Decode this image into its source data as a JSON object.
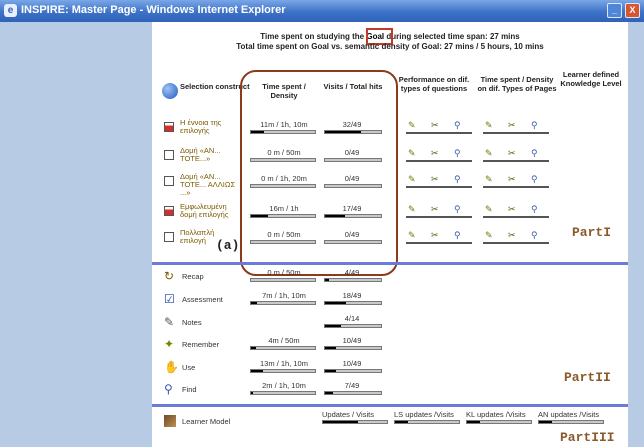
{
  "window": {
    "title": "INSPIRE: Master Page - Windows Internet Explorer",
    "icon": "ie-icon",
    "min_label": "_",
    "close_label": "X"
  },
  "summary": {
    "line1_prefix": "Time spent on studying the ",
    "line1_goal": "Goal",
    "line1_suffix": " during selected time span: 27 mins",
    "line2": "Total time spent on Goal vs. semantic density of Goal: 27 mins / 5 hours, 10 mins"
  },
  "headers": {
    "selection": "Selection construct",
    "time_density": "Time spent / Density",
    "visits": "Visits / Total hits",
    "performance": "Performance on dif. types of questions",
    "time_pages": "Time spent / Density on dif. Types of Pages",
    "learner_level": "Learner defined Knowledge Level"
  },
  "constructs": [
    {
      "label": "Η έννοια της επιλογής",
      "time": "11m / 1h, 10m",
      "visits": "32/49",
      "checked": true,
      "time_fill": 0.2,
      "visit_fill": 0.65
    },
    {
      "label": "Δομή «ΑΝ... ΤΟΤΕ...»",
      "time": "0 m / 50m",
      "visits": "0/49",
      "checked": false,
      "time_fill": 0,
      "visit_fill": 0
    },
    {
      "label": "Δομή «ΑΝ... ΤΟΤΕ... ΑΛΛΙΩΣ ...»",
      "time": "0 m / 1h, 20m",
      "visits": "0/49",
      "checked": false,
      "time_fill": 0,
      "visit_fill": 0
    },
    {
      "label": "Εμφωλευμένη δομή επιλογής",
      "time": "16m / 1h",
      "visits": "17/49",
      "checked": true,
      "time_fill": 0.27,
      "visit_fill": 0.35
    },
    {
      "label": "Πολλαπλή επιλογή",
      "time": "0 m / 50m",
      "visits": "0/49",
      "checked": false,
      "time_fill": 0,
      "visit_fill": 0
    }
  ],
  "annotation_a": "(a)",
  "part_labels": {
    "p1": "PartI",
    "p2": "PartII",
    "p3": "PartIII"
  },
  "activities": [
    {
      "label": "Recap",
      "icon": "recap-icon",
      "time": "0 m / 50m",
      "visits": "4/49",
      "time_fill": 0,
      "visit_fill": 0.08
    },
    {
      "label": "Assessment",
      "icon": "assessment-icon",
      "time": "7m / 1h, 10m",
      "visits": "18/49",
      "time_fill": 0.1,
      "visit_fill": 0.37
    },
    {
      "label": "Notes",
      "icon": "notes-icon",
      "time": "",
      "visits": "4/14",
      "time_fill": null,
      "visit_fill": 0.28
    },
    {
      "label": "Remember",
      "icon": "remember-icon",
      "time": "4m / 50m",
      "visits": "10/49",
      "time_fill": 0.08,
      "visit_fill": 0.2
    },
    {
      "label": "Use",
      "icon": "use-icon",
      "time": "13m / 1h, 10m",
      "visits": "10/49",
      "time_fill": 0.19,
      "visit_fill": 0.2
    },
    {
      "label": "Find",
      "icon": "find-icon",
      "time": "2m / 1h, 10m",
      "visits": "7/49",
      "time_fill": 0.03,
      "visit_fill": 0.14
    }
  ],
  "learner_model": {
    "label": "Learner Model",
    "icon": "learner-model-icon",
    "updates": "Updates / Visits",
    "ls": "LS updates /Visits",
    "kl": "KL updates /Visits",
    "an": "AN updates /Visits",
    "update_fills": [
      0.55,
      0.2,
      0.2,
      0.2
    ]
  },
  "colors": {
    "accent_red": "#c0392b",
    "oval": "#8b3a1a",
    "divider": "#6d7bd8",
    "sidebar": "#b7cbe4"
  }
}
